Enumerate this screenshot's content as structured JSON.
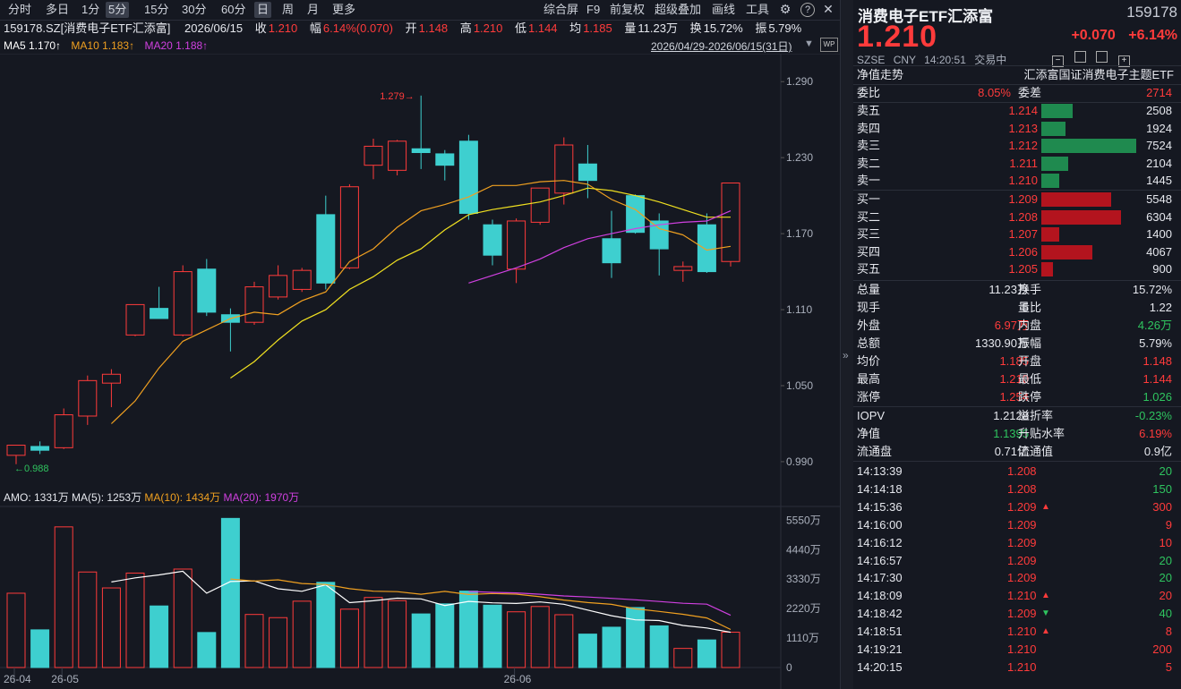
{
  "toolbar": {
    "periods": [
      "分时",
      "多日",
      "1分",
      "5分",
      "15分",
      "30分",
      "60分",
      "日",
      "周",
      "月",
      "更多"
    ],
    "selected_period": "日",
    "tools": [
      "综合屏",
      "F9",
      "前复权",
      "超级叠加",
      "画线",
      "工具"
    ]
  },
  "quote_bar": {
    "code_name": "159178.SZ[消费电子ETF汇添富]",
    "date": "2026/06/15",
    "close_label": "收",
    "close": "1.210",
    "change_label": "幅",
    "change": "6.14%(0.070)",
    "open_label": "开",
    "open": "1.148",
    "high_label": "高",
    "high": "1.210",
    "low_label": "低",
    "low": "1.144",
    "avg_label": "均",
    "avg": "1.185",
    "volume_label": "量",
    "volume": "11.23万",
    "turnover_label": "换",
    "turnover": "15.72%",
    "amplitude_label": "振",
    "amplitude": "5.79%"
  },
  "ma_legend": {
    "ma5": "MA5 1.170↑",
    "ma10": "MA10 1.183↑",
    "ma20": "MA20 1.188↑",
    "date_range": "2026/04/29-2026/06/15(31日)"
  },
  "colors": {
    "up": "#ff3b3b",
    "down": "#3ecfcf",
    "ma5": "#ffffff",
    "ma10": "#f0a020",
    "ma20": "#d040e0",
    "mama5_k": "#f0a020"
  },
  "chart_data": {
    "type": "candlestick",
    "price_axis": [
      "1.290",
      "1.230",
      "1.170",
      "1.110",
      "1.050",
      "0.990"
    ],
    "price_range": [
      0.973,
      1.305
    ],
    "annotations": {
      "high": "1.279",
      "low": "0.988"
    },
    "candles": [
      {
        "o": 0.995,
        "h": 1.003,
        "l": 0.988,
        "c": 1.003
      },
      {
        "o": 1.002,
        "h": 1.006,
        "l": 0.996,
        "c": 0.999
      },
      {
        "o": 1.001,
        "h": 1.032,
        "l": 1.0,
        "c": 1.027
      },
      {
        "o": 1.026,
        "h": 1.058,
        "l": 1.019,
        "c": 1.054
      },
      {
        "o": 1.052,
        "h": 1.063,
        "l": 1.033,
        "c": 1.059
      },
      {
        "o": 1.09,
        "h": 1.113,
        "l": 1.089,
        "c": 1.114
      },
      {
        "o": 1.111,
        "h": 1.128,
        "l": 1.103,
        "c": 1.103
      },
      {
        "o": 1.09,
        "h": 1.145,
        "l": 1.089,
        "c": 1.14
      },
      {
        "o": 1.142,
        "h": 1.15,
        "l": 1.105,
        "c": 1.108
      },
      {
        "o": 1.106,
        "h": 1.111,
        "l": 1.077,
        "c": 1.1
      },
      {
        "o": 1.1,
        "h": 1.132,
        "l": 1.098,
        "c": 1.128
      },
      {
        "o": 1.12,
        "h": 1.145,
        "l": 1.118,
        "c": 1.137
      },
      {
        "o": 1.126,
        "h": 1.143,
        "l": 1.124,
        "c": 1.141
      },
      {
        "o": 1.185,
        "h": 1.2,
        "l": 1.126,
        "c": 1.131
      },
      {
        "o": 1.143,
        "h": 1.209,
        "l": 1.142,
        "c": 1.207
      },
      {
        "o": 1.224,
        "h": 1.245,
        "l": 1.213,
        "c": 1.239
      },
      {
        "o": 1.22,
        "h": 1.244,
        "l": 1.216,
        "c": 1.243
      },
      {
        "o": 1.237,
        "h": 1.279,
        "l": 1.221,
        "c": 1.234
      },
      {
        "o": 1.233,
        "h": 1.236,
        "l": 1.212,
        "c": 1.224
      },
      {
        "o": 1.243,
        "h": 1.248,
        "l": 1.181,
        "c": 1.186
      },
      {
        "o": 1.177,
        "h": 1.181,
        "l": 1.145,
        "c": 1.153
      },
      {
        "o": 1.142,
        "h": 1.182,
        "l": 1.131,
        "c": 1.18
      },
      {
        "o": 1.179,
        "h": 1.204,
        "l": 1.177,
        "c": 1.206
      },
      {
        "o": 1.202,
        "h": 1.246,
        "l": 1.193,
        "c": 1.24
      },
      {
        "o": 1.225,
        "h": 1.24,
        "l": 1.198,
        "c": 1.212
      },
      {
        "o": 1.166,
        "h": 1.188,
        "l": 1.135,
        "c": 1.147
      },
      {
        "o": 1.2,
        "h": 1.201,
        "l": 1.17,
        "c": 1.171
      },
      {
        "o": 1.18,
        "h": 1.186,
        "l": 1.137,
        "c": 1.158
      },
      {
        "o": 1.141,
        "h": 1.148,
        "l": 1.132,
        "c": 1.144
      },
      {
        "o": 1.177,
        "h": 1.186,
        "l": 1.139,
        "c": 1.14
      },
      {
        "o": 1.148,
        "h": 1.21,
        "l": 1.144,
        "c": 1.21
      }
    ],
    "ma5": [
      null,
      null,
      null,
      null,
      1.02,
      1.038,
      1.064,
      1.085,
      1.094,
      1.103,
      1.108,
      1.106,
      1.117,
      1.124,
      1.148,
      1.158,
      1.175,
      1.188,
      1.193,
      1.199,
      1.208,
      1.208,
      1.211,
      1.212,
      1.209,
      1.197,
      1.189,
      1.174,
      1.169,
      1.157,
      1.16
    ],
    "ma10": [
      null,
      null,
      null,
      null,
      null,
      null,
      null,
      null,
      null,
      1.056,
      1.069,
      1.086,
      1.101,
      1.11,
      1.126,
      1.136,
      1.149,
      1.158,
      1.173,
      1.185,
      1.189,
      1.192,
      1.195,
      1.2,
      1.206,
      1.204,
      1.2,
      1.195,
      1.189,
      1.183,
      1.183
    ],
    "ma20": [
      null,
      null,
      null,
      null,
      null,
      null,
      null,
      null,
      null,
      null,
      null,
      null,
      null,
      null,
      null,
      null,
      null,
      null,
      null,
      1.131,
      1.137,
      1.143,
      1.15,
      1.159,
      1.166,
      1.17,
      1.174,
      1.177,
      1.179,
      1.18,
      1.188
    ],
    "x_labels": [
      {
        "i": 0,
        "t": "26-04"
      },
      {
        "i": 2,
        "t": "26-05"
      },
      {
        "i": 21,
        "t": "26-06"
      }
    ],
    "volume": {
      "legend": {
        "amo": "AMO: 1331万",
        "ma5": "MA(5): 1253万",
        "ma10": "MA(10): 1434万",
        "ma20": "MA(20): 1970万"
      },
      "axis": [
        "5550万",
        "4440万",
        "3330万",
        "2220万",
        "1110万",
        "0"
      ],
      "max": 5800,
      "values": [
        2800,
        1420,
        5300,
        3600,
        3000,
        3560,
        2320,
        3710,
        1320,
        5620,
        2000,
        1880,
        2500,
        3210,
        2200,
        2640,
        2520,
        2020,
        2400,
        2880,
        2350,
        2100,
        2300,
        1990,
        1260,
        1520,
        2260,
        1570,
        720,
        1040,
        1331
      ],
      "ma5": [
        null,
        null,
        null,
        null,
        3224,
        3378,
        3490,
        3630,
        2802,
        3242,
        3264,
        2966,
        2874,
        3118,
        2446,
        2516,
        2614,
        2586,
        2337,
        2492,
        2437,
        2416,
        2472,
        2384,
        2164,
        1954,
        1797,
        1772,
        1585,
        1489,
        1330
      ],
      "ma10": [
        null,
        null,
        null,
        null,
        null,
        null,
        null,
        null,
        null,
        3336,
        3257,
        3303,
        3168,
        3130,
        2970,
        2877,
        2858,
        2763,
        2870,
        2751,
        2789,
        2765,
        2668,
        2544,
        2449,
        2380,
        2213,
        2114,
        2007,
        1867,
        1434
      ],
      "ma20": [
        null,
        null,
        null,
        null,
        null,
        null,
        null,
        null,
        null,
        null,
        null,
        null,
        null,
        null,
        null,
        null,
        null,
        null,
        null,
        2866,
        2834,
        2812,
        2763,
        2697,
        2656,
        2607,
        2551,
        2490,
        2420,
        2386,
        1970
      ]
    }
  },
  "panel": {
    "title": "消费电子ETF汇添富",
    "code": "159178",
    "price": "1.210",
    "change": "+0.070",
    "change_pct": "+6.14%",
    "exchange": "SZSE",
    "currency": "CNY",
    "time": "14:20:51",
    "state": "交易中",
    "section_left": "净值走势",
    "section_right": "汇添富国证消费电子主题ETF",
    "weibi_label": "委比",
    "weibi": "8.05%",
    "weicha_label": "委差",
    "weicha": "2714",
    "asks": [
      {
        "label": "卖五",
        "price": "1.214",
        "vol": "2508",
        "v": 2508
      },
      {
        "label": "卖四",
        "price": "1.213",
        "vol": "1924",
        "v": 1924
      },
      {
        "label": "卖三",
        "price": "1.212",
        "vol": "7524",
        "v": 7524
      },
      {
        "label": "卖二",
        "price": "1.211",
        "vol": "2104",
        "v": 2104
      },
      {
        "label": "卖一",
        "price": "1.210",
        "vol": "1445",
        "v": 1445
      }
    ],
    "bids": [
      {
        "label": "买一",
        "price": "1.209",
        "vol": "5548",
        "v": 5548
      },
      {
        "label": "买二",
        "price": "1.208",
        "vol": "6304",
        "v": 6304
      },
      {
        "label": "买三",
        "price": "1.207",
        "vol": "1400",
        "v": 1400
      },
      {
        "label": "买四",
        "price": "1.206",
        "vol": "4067",
        "v": 4067
      },
      {
        "label": "买五",
        "price": "1.205",
        "vol": "900",
        "v": 900
      }
    ],
    "stats": [
      [
        {
          "l": "总量",
          "v": "11.23万",
          "c": "wh"
        },
        {
          "l": "换手",
          "v": "15.72%",
          "c": "wh"
        }
      ],
      [
        {
          "l": "现手",
          "v": "5",
          "c": "wh"
        },
        {
          "l": "量比",
          "v": "1.22",
          "c": "wh"
        }
      ],
      [
        {
          "l": "外盘",
          "v": "6.97万",
          "c": "up"
        },
        {
          "l": "内盘",
          "v": "4.26万",
          "c": "dn"
        }
      ],
      [
        {
          "l": "总额",
          "v": "1330.90万",
          "c": "wh"
        },
        {
          "l": "振幅",
          "v": "5.79%",
          "c": "wh"
        }
      ],
      [
        {
          "l": "均价",
          "v": "1.185",
          "c": "up"
        },
        {
          "l": "开盘",
          "v": "1.148",
          "c": "up"
        }
      ],
      [
        {
          "l": "最高",
          "v": "1.210",
          "c": "up"
        },
        {
          "l": "最低",
          "v": "1.144",
          "c": "up"
        }
      ],
      [
        {
          "l": "涨停",
          "v": "1.254",
          "c": "up"
        },
        {
          "l": "跌停",
          "v": "1.026",
          "c": "dn"
        }
      ]
    ],
    "stats2": [
      [
        {
          "l": "IOPV",
          "v": "1.2128",
          "c": "wh"
        },
        {
          "l": "溢折率",
          "v": "-0.23%",
          "c": "dn"
        }
      ],
      [
        {
          "l": "净值",
          "v": "1.1395",
          "c": "dn"
        },
        {
          "l": "升贴水率",
          "v": "6.19%",
          "c": "up"
        }
      ],
      [
        {
          "l": "流通盘",
          "v": "0.71亿",
          "c": "wh"
        },
        {
          "l": "流通值",
          "v": "0.9亿",
          "c": "wh"
        }
      ]
    ],
    "ticks": [
      {
        "t": "14:13:39",
        "p": "1.208",
        "a": "",
        "v": "20",
        "vc": "dn"
      },
      {
        "t": "14:14:18",
        "p": "1.208",
        "a": "",
        "v": "150",
        "vc": "dn"
      },
      {
        "t": "14:15:36",
        "p": "1.209",
        "a": "up",
        "v": "300",
        "vc": "up"
      },
      {
        "t": "14:16:00",
        "p": "1.209",
        "a": "",
        "v": "9",
        "vc": "up"
      },
      {
        "t": "14:16:12",
        "p": "1.209",
        "a": "",
        "v": "10",
        "vc": "up"
      },
      {
        "t": "14:16:57",
        "p": "1.209",
        "a": "",
        "v": "20",
        "vc": "dn"
      },
      {
        "t": "14:17:30",
        "p": "1.209",
        "a": "",
        "v": "20",
        "vc": "dn"
      },
      {
        "t": "14:18:09",
        "p": "1.210",
        "a": "up",
        "v": "20",
        "vc": "up"
      },
      {
        "t": "14:18:42",
        "p": "1.209",
        "a": "dn",
        "v": "40",
        "vc": "dn"
      },
      {
        "t": "14:18:51",
        "p": "1.210",
        "a": "up",
        "v": "8",
        "vc": "up"
      },
      {
        "t": "14:19:21",
        "p": "1.210",
        "a": "",
        "v": "200",
        "vc": "up"
      },
      {
        "t": "14:20:15",
        "p": "1.210",
        "a": "",
        "v": "5",
        "vc": "up"
      }
    ]
  }
}
